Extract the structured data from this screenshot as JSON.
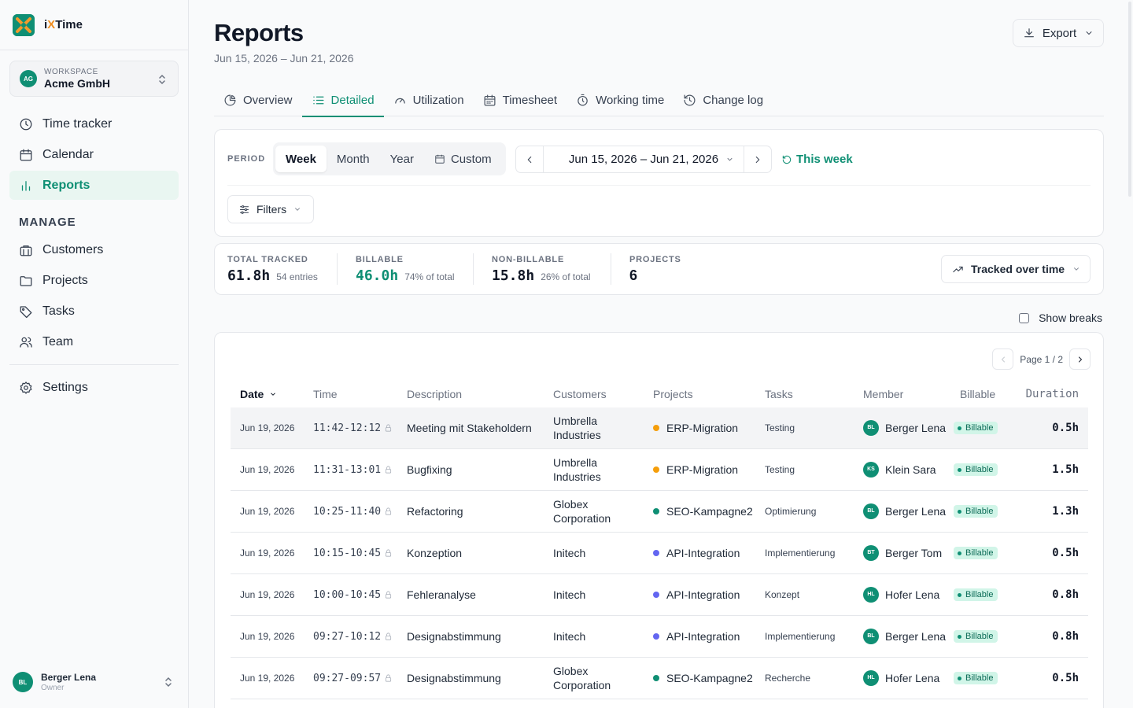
{
  "brand": {
    "name_prefix": "i",
    "name_x": "X",
    "name_suffix": "Time"
  },
  "workspace": {
    "label": "WORKSPACE",
    "name": "Acme GmbH",
    "initials": "AG"
  },
  "nav": {
    "time_tracker": "Time tracker",
    "calendar": "Calendar",
    "reports": "Reports",
    "manage_title": "MANAGE",
    "customers": "Customers",
    "projects": "Projects",
    "tasks": "Tasks",
    "team": "Team",
    "settings": "Settings"
  },
  "user": {
    "name": "Berger Lena",
    "role": "Owner",
    "initials": "BL"
  },
  "page": {
    "title": "Reports",
    "subtitle": "Jun 15, 2026 – Jun 21, 2026",
    "export_label": "Export"
  },
  "tabs": [
    "Overview",
    "Detailed",
    "Utilization",
    "Timesheet",
    "Working time",
    "Change log"
  ],
  "period": {
    "label": "PERIOD",
    "options": [
      "Week",
      "Month",
      "Year",
      "Custom"
    ],
    "range": "Jun 15, 2026 – Jun 21, 2026",
    "this_week": "This week",
    "filters": "Filters"
  },
  "stats": {
    "total": {
      "label": "TOTAL TRACKED",
      "value": "61.8h",
      "note": "54 entries"
    },
    "billable": {
      "label": "BILLABLE",
      "value": "46.0h",
      "note": "74% of total"
    },
    "nonbillable": {
      "label": "NON-BILLABLE",
      "value": "15.8h",
      "note": "26% of total"
    },
    "projects": {
      "label": "PROJECTS",
      "value": "6"
    },
    "trend_label": "Tracked over time"
  },
  "show_breaks": "Show breaks",
  "pager": {
    "text": "Page 1 / 2"
  },
  "table": {
    "headers": {
      "date": "Date",
      "time": "Time",
      "description": "Description",
      "customers": "Customers",
      "projects": "Projects",
      "tasks": "Tasks",
      "member": "Member",
      "billable": "Billable",
      "duration": "Duration"
    },
    "rows": [
      {
        "date": "Jun 19, 2026",
        "time": "11:42-12:12",
        "description": "Meeting mit Stakeholdern",
        "customer": "Umbrella Industries",
        "project": "ERP-Migration",
        "project_color": "#f59e0b",
        "task": "Testing",
        "member": "Berger Lena",
        "member_initials": "BL",
        "billable": "Billable",
        "duration": "0.5h"
      },
      {
        "date": "Jun 19, 2026",
        "time": "11:31-13:01",
        "description": "Bugfixing",
        "customer": "Umbrella Industries",
        "project": "ERP-Migration",
        "project_color": "#f59e0b",
        "task": "Testing",
        "member": "Klein Sara",
        "member_initials": "KS",
        "billable": "Billable",
        "duration": "1.5h"
      },
      {
        "date": "Jun 19, 2026",
        "time": "10:25-11:40",
        "description": "Refactoring",
        "customer": "Globex Corporation",
        "project": "SEO-Kampagne2",
        "project_color": "#0f8f74",
        "task": "Optimierung",
        "member": "Berger Lena",
        "member_initials": "BL",
        "billable": "Billable",
        "duration": "1.3h"
      },
      {
        "date": "Jun 19, 2026",
        "time": "10:15-10:45",
        "description": "Konzeption",
        "customer": "Initech",
        "project": "API-Integration",
        "project_color": "#6366f1",
        "task": "Implementierung",
        "member": "Berger Tom",
        "member_initials": "BT",
        "billable": "Billable",
        "duration": "0.5h"
      },
      {
        "date": "Jun 19, 2026",
        "time": "10:00-10:45",
        "description": "Fehleranalyse",
        "customer": "Initech",
        "project": "API-Integration",
        "project_color": "#6366f1",
        "task": "Konzept",
        "member": "Hofer Lena",
        "member_initials": "HL",
        "billable": "Billable",
        "duration": "0.8h"
      },
      {
        "date": "Jun 19, 2026",
        "time": "09:27-10:12",
        "description": "Designabstimmung",
        "customer": "Initech",
        "project": "API-Integration",
        "project_color": "#6366f1",
        "task": "Implementierung",
        "member": "Berger Lena",
        "member_initials": "BL",
        "billable": "Billable",
        "duration": "0.8h"
      },
      {
        "date": "Jun 19, 2026",
        "time": "09:27-09:57",
        "description": "Designabstimmung",
        "customer": "Globex Corporation",
        "project": "SEO-Kampagne2",
        "project_color": "#0f8f74",
        "task": "Recherche",
        "member": "Hofer Lena",
        "member_initials": "HL",
        "billable": "Billable",
        "duration": "0.5h"
      }
    ]
  }
}
